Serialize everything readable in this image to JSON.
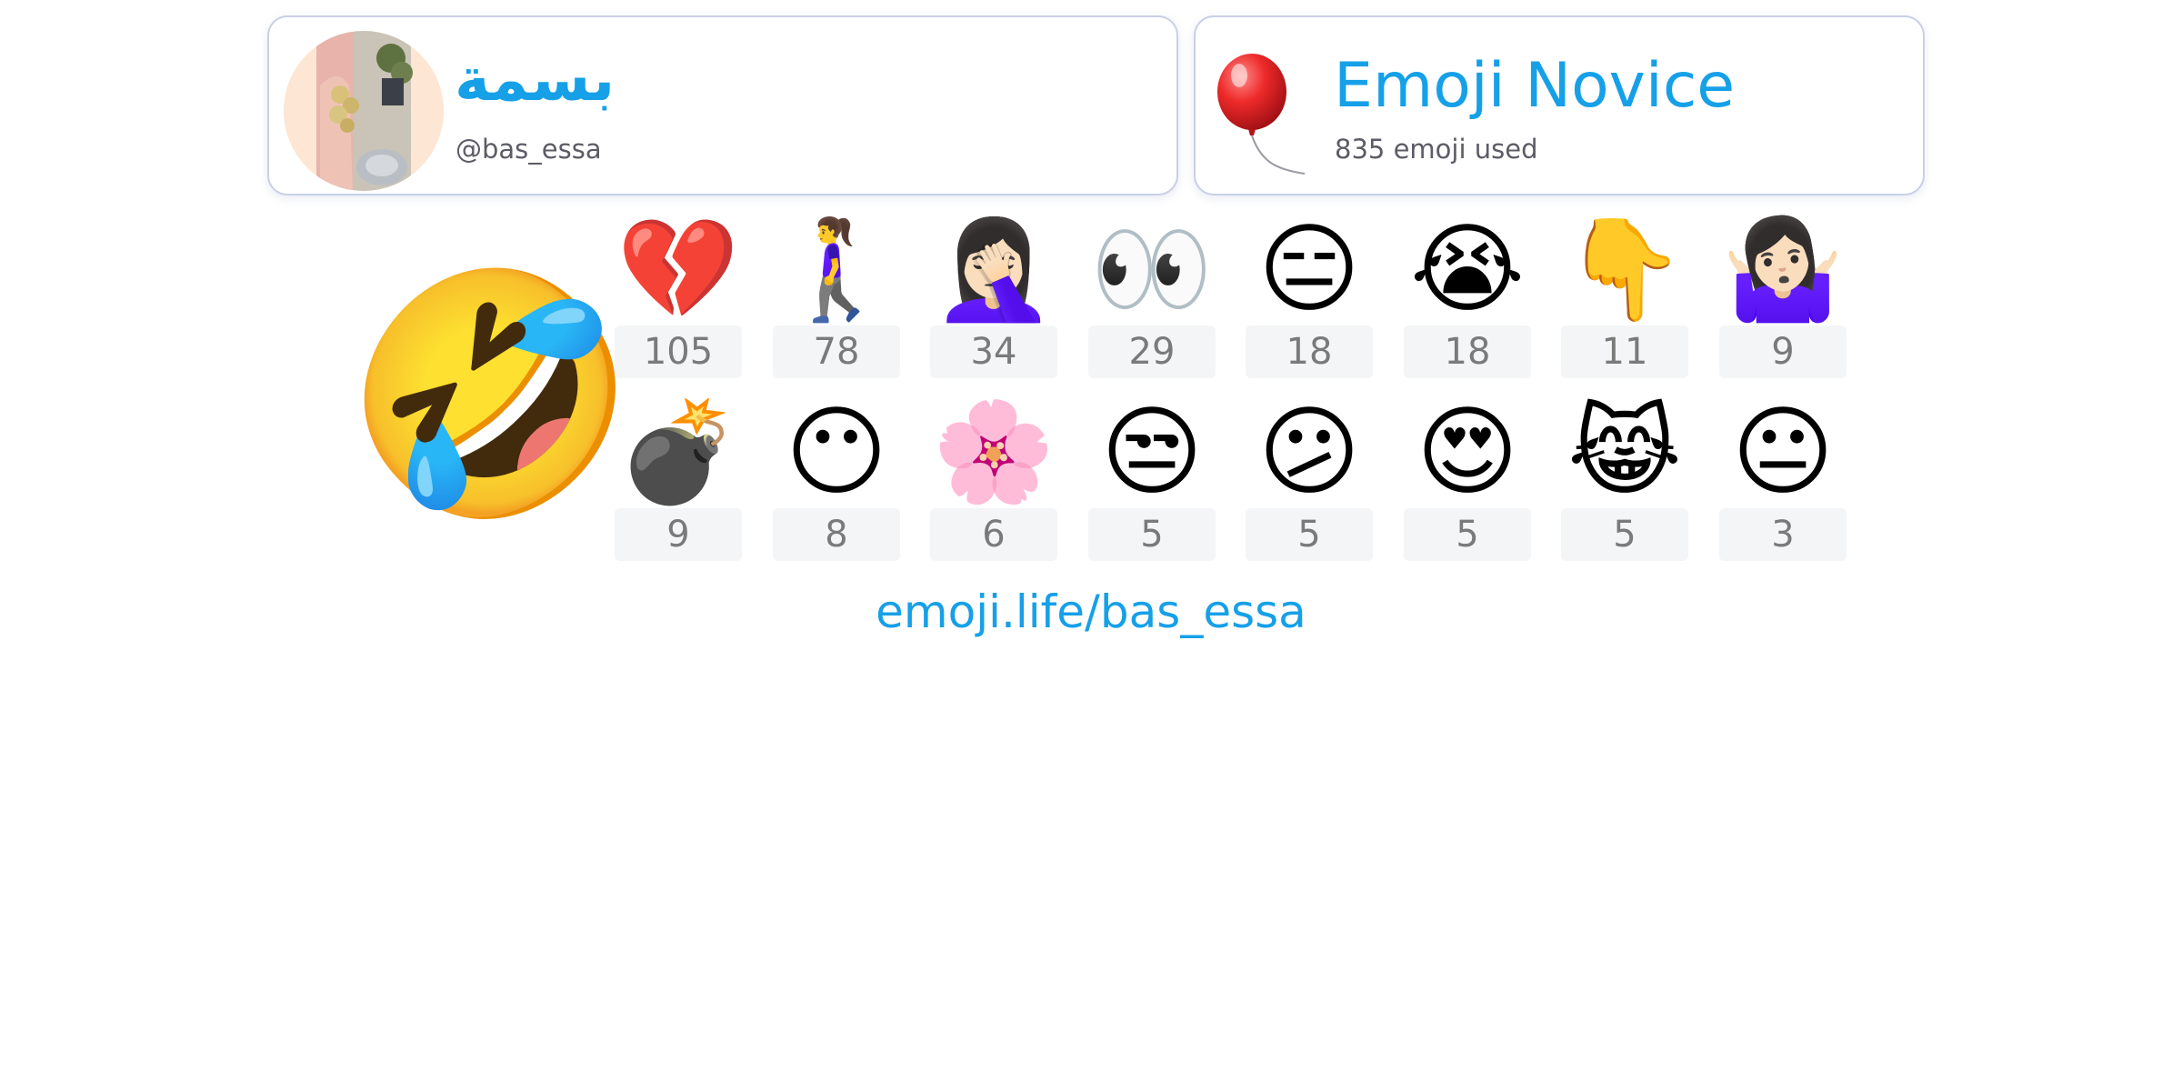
{
  "profile": {
    "name": "بسمة",
    "handle": "@bas_essa"
  },
  "badge": {
    "title": "Emoji Novice",
    "subtitle": "835 emoji used",
    "icon": "balloon-icon"
  },
  "top_emoji": {
    "emoji": "🤣",
    "icon": "rolling-on-floor-laughing-icon"
  },
  "emoji_stats": [
    {
      "emoji": "💔",
      "count": "105",
      "icon": "broken-heart-icon"
    },
    {
      "emoji": "🚶‍♀️",
      "count": "78",
      "icon": "woman-walking-icon"
    },
    {
      "emoji": "🤦🏻‍♀️",
      "count": "34",
      "icon": "woman-facepalming-icon"
    },
    {
      "emoji": "👀",
      "count": "29",
      "icon": "eyes-icon"
    },
    {
      "emoji": "😑",
      "count": "18",
      "icon": "expressionless-face-icon"
    },
    {
      "emoji": "😭",
      "count": "18",
      "icon": "loudly-crying-face-icon"
    },
    {
      "emoji": "👇",
      "count": "11",
      "icon": "backhand-index-pointing-down-icon"
    },
    {
      "emoji": "🤷🏻‍♀️",
      "count": "9",
      "icon": "woman-shrugging-icon"
    },
    {
      "emoji": "💣",
      "count": "9",
      "icon": "bomb-icon"
    },
    {
      "emoji": "😶",
      "count": "8",
      "icon": "face-without-mouth-icon"
    },
    {
      "emoji": "🌸",
      "count": "6",
      "icon": "cherry-blossom-icon"
    },
    {
      "emoji": "😒",
      "count": "5",
      "icon": "unamused-face-icon"
    },
    {
      "emoji": "😕",
      "count": "5",
      "icon": "confused-face-icon"
    },
    {
      "emoji": "😍",
      "count": "5",
      "icon": "heart-eyes-face-icon"
    },
    {
      "emoji": "😹",
      "count": "5",
      "icon": "cat-with-tears-of-joy-icon"
    },
    {
      "emoji": "😐",
      "count": "3",
      "icon": "neutral-face-icon"
    }
  ],
  "footer": {
    "link_text": "emoji.life/bas_essa"
  },
  "colors": {
    "accent": "#16a0e8",
    "muted_text": "#5c5c66",
    "count_text": "#7a7a7a",
    "count_bg": "#f4f5f7",
    "card_border": "#c9cfe6"
  }
}
